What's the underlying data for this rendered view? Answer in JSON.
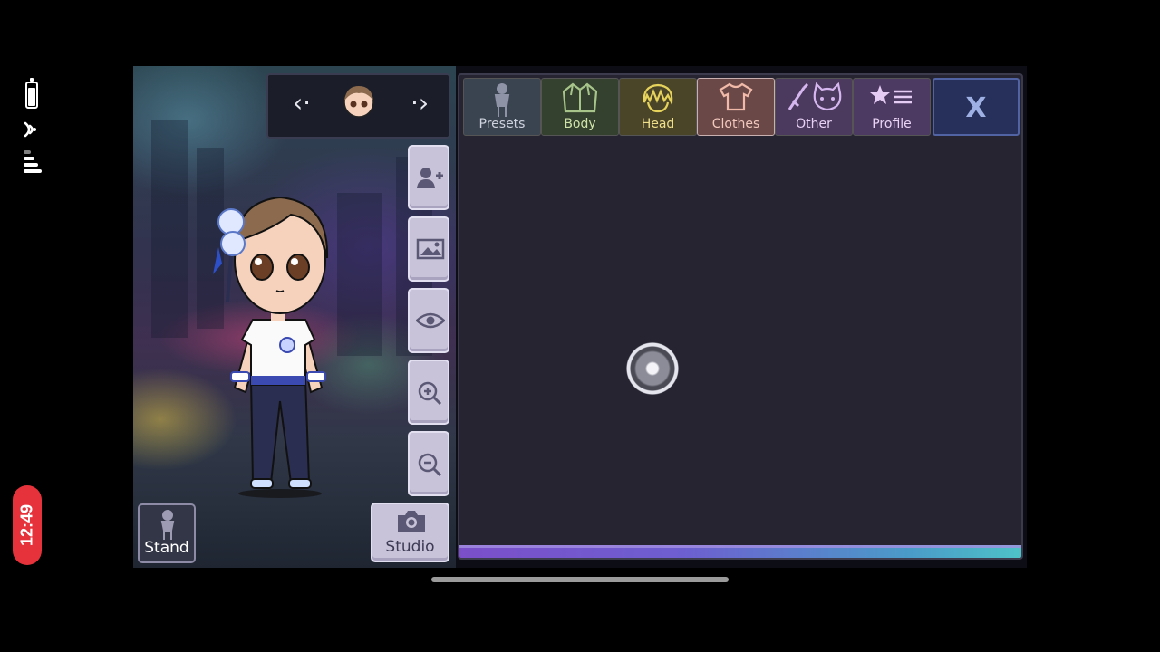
{
  "status_bar": {
    "time": "12:49"
  },
  "selector": {
    "prev_icon": "chevron-left-icon",
    "next_icon": "chevron-right-icon",
    "prev_glyph": "‹·",
    "next_glyph": "·›"
  },
  "toolbar": {
    "buttons": [
      {
        "name": "add-character-button",
        "icon": "add-user-icon"
      },
      {
        "name": "background-button",
        "icon": "image-icon"
      },
      {
        "name": "visibility-button",
        "icon": "eye-icon"
      },
      {
        "name": "zoom-in-button",
        "icon": "zoom-in-icon"
      },
      {
        "name": "zoom-out-button",
        "icon": "zoom-out-icon"
      }
    ],
    "stand_label": "Stand",
    "studio_label": "Studio"
  },
  "tabs": [
    {
      "label": "Presets",
      "icon": "mannequin-icon",
      "color": "#cfd3df",
      "bg": "#3a4450",
      "active": false
    },
    {
      "label": "Body",
      "icon": "jacket-icon",
      "color": "#cfe3a8",
      "bg": "#34412e",
      "active": false
    },
    {
      "label": "Head",
      "icon": "hair-icon",
      "color": "#f0e08a",
      "bg": "#4a4528",
      "active": false
    },
    {
      "label": "Clothes",
      "icon": "shirt-icon",
      "color": "#f3c9bd",
      "bg": "#6a4848",
      "active": true
    },
    {
      "label": "Other",
      "icon": "sword-cat-icon",
      "color": "#e8d2f5",
      "bg": "#4b3a5e",
      "active": false
    },
    {
      "label": "Profile",
      "icon": "star-list-icon",
      "color": "#e9d4f4",
      "bg": "#4d3a62",
      "active": false
    }
  ],
  "close": {
    "label": "X"
  },
  "colors": {
    "accent_bar_start": "#7b4fc9",
    "accent_bar_end": "#4ec2c8",
    "panel_bg": "#252430"
  },
  "loading": {
    "icon": "loading-spinner-icon"
  }
}
